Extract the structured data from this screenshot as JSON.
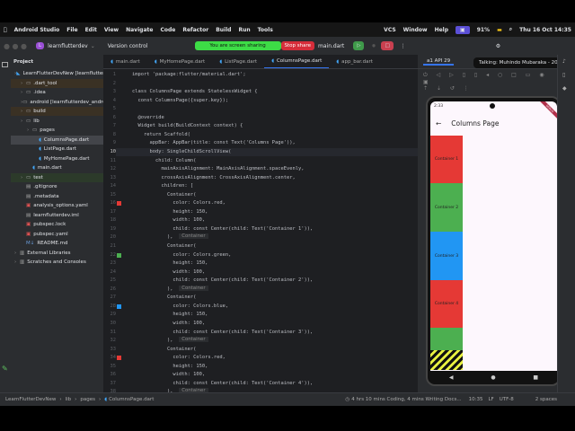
{
  "menubar": {
    "app": "Android Studio",
    "items": [
      "File",
      "Edit",
      "View",
      "Navigate",
      "Code",
      "Refactor",
      "Build",
      "Run",
      "Tools"
    ],
    "right_items": [
      "VCS",
      "Window",
      "Help"
    ],
    "battery": "91%",
    "clock": "Thu 16 Oct 14:35"
  },
  "toolbar": {
    "project_initial": "L",
    "project": "learnflutterdev",
    "vcs": "Version control",
    "sharing": "You are screen sharing",
    "stop_share": "Stop share",
    "run_config": "main.dart"
  },
  "tabs": [
    {
      "label": "main.dart"
    },
    {
      "label": "MyHomePage.dart"
    },
    {
      "label": "ListPage.dart"
    },
    {
      "label": "ColumnsPage.dart",
      "active": true
    },
    {
      "label": "app_bar.dart"
    }
  ],
  "project": {
    "header": "Project",
    "items": [
      {
        "label": "LearnFlutterDevNew [learnflutterdev]",
        "depth": 0,
        "type": "root"
      },
      {
        "label": ".dart_tool",
        "depth": 1,
        "type": "folder"
      },
      {
        "label": ".idea",
        "depth": 1,
        "type": "folder"
      },
      {
        "label": "android [learnflutterdev_android]",
        "depth": 1,
        "type": "folder"
      },
      {
        "label": "build",
        "depth": 1,
        "type": "folder"
      },
      {
        "label": "lib",
        "depth": 1,
        "type": "folder"
      },
      {
        "label": "pages",
        "depth": 2,
        "type": "folder"
      },
      {
        "label": "ColumnsPage.dart",
        "depth": 3,
        "type": "dart",
        "selected": true
      },
      {
        "label": "ListPage.dart",
        "depth": 3,
        "type": "dart"
      },
      {
        "label": "MyHomePage.dart",
        "depth": 3,
        "type": "dart"
      },
      {
        "label": "main.dart",
        "depth": 2,
        "type": "dart"
      },
      {
        "label": "test",
        "depth": 1,
        "type": "folder"
      },
      {
        "label": ".gitignore",
        "depth": 1,
        "type": "file"
      },
      {
        "label": ".metadata",
        "depth": 1,
        "type": "file"
      },
      {
        "label": "analysis_options.yaml",
        "depth": 1,
        "type": "yaml"
      },
      {
        "label": "learnflutterdev.iml",
        "depth": 1,
        "type": "file"
      },
      {
        "label": "pubspec.lock",
        "depth": 1,
        "type": "yaml"
      },
      {
        "label": "pubspec.yaml",
        "depth": 1,
        "type": "yaml"
      },
      {
        "label": "README.md",
        "depth": 1,
        "type": "md"
      },
      {
        "label": "External Libraries",
        "depth": 0,
        "type": "lib"
      },
      {
        "label": "Scratches and Consoles",
        "depth": 0,
        "type": "lib"
      }
    ]
  },
  "editor": {
    "current_line": 10,
    "hint": "Container",
    "lines": [
      "import 'package:flutter/material.dart';",
      "",
      "class ColumnsPage extends StatelessWidget {",
      "  const ColumnsPage({super.key});",
      "",
      "  @override",
      "  Widget build(BuildContext context) {",
      "    return Scaffold(",
      "      appBar: AppBar(title: const Text('Columns Page')),",
      "      body: SingleChildScrollView(",
      "        child: Column(",
      "          mainAxisAlignment: MainAxisAlignment.spaceEvenly,",
      "          crossAxisAlignment: CrossAxisAlignment.center,",
      "          children: [",
      "            Container(",
      "              color: Colors.red,",
      "              height: 150,",
      "              width: 100,",
      "              child: const Center(child: Text('Container 1')),",
      "            ),",
      "            Container(",
      "              color: Colors.green,",
      "              height: 150,",
      "              width: 100,",
      "              child: const Center(child: Text('Container 2')),",
      "            ),",
      "            Container(",
      "              color: Colors.blue,",
      "              height: 150,",
      "              width: 100,",
      "              child: const Center(child: Text('Container 3')),",
      "            ),",
      "            Container(",
      "              color: Colors.red,",
      "              height: 150,",
      "              width: 100,",
      "              child: const Center(child: Text('Container 4')),",
      "            ),"
    ],
    "gutter_colors": {
      "16": "#e53935",
      "22": "#4caf50",
      "28": "#2196f3",
      "34": "#e53935"
    }
  },
  "emulator": {
    "device_tab": "a1 API 29",
    "talking": "Talking: Muhindo Mubaraka - 202...",
    "time": "2:33",
    "app_title": "Columns Page",
    "debug_banner": "DEBUG",
    "containers": [
      {
        "label": "Container 1",
        "color": "#e53935"
      },
      {
        "label": "Container 2",
        "color": "#4caf50"
      },
      {
        "label": "Container 3",
        "color": "#2196f3"
      },
      {
        "label": "Container 4",
        "color": "#e53935"
      },
      {
        "label": "",
        "color": "#4caf50"
      }
    ]
  },
  "statusbar": {
    "breadcrumb": [
      "LearnFlutterDevNew",
      "lib",
      "pages",
      "ColumnsPage.dart"
    ],
    "activity": "4 hrs 10 mins Coding, 4 mins Writing Docs...",
    "position": "10:35",
    "line_sep": "LF",
    "encoding": "UTF-8",
    "indent": "2 spaces"
  }
}
